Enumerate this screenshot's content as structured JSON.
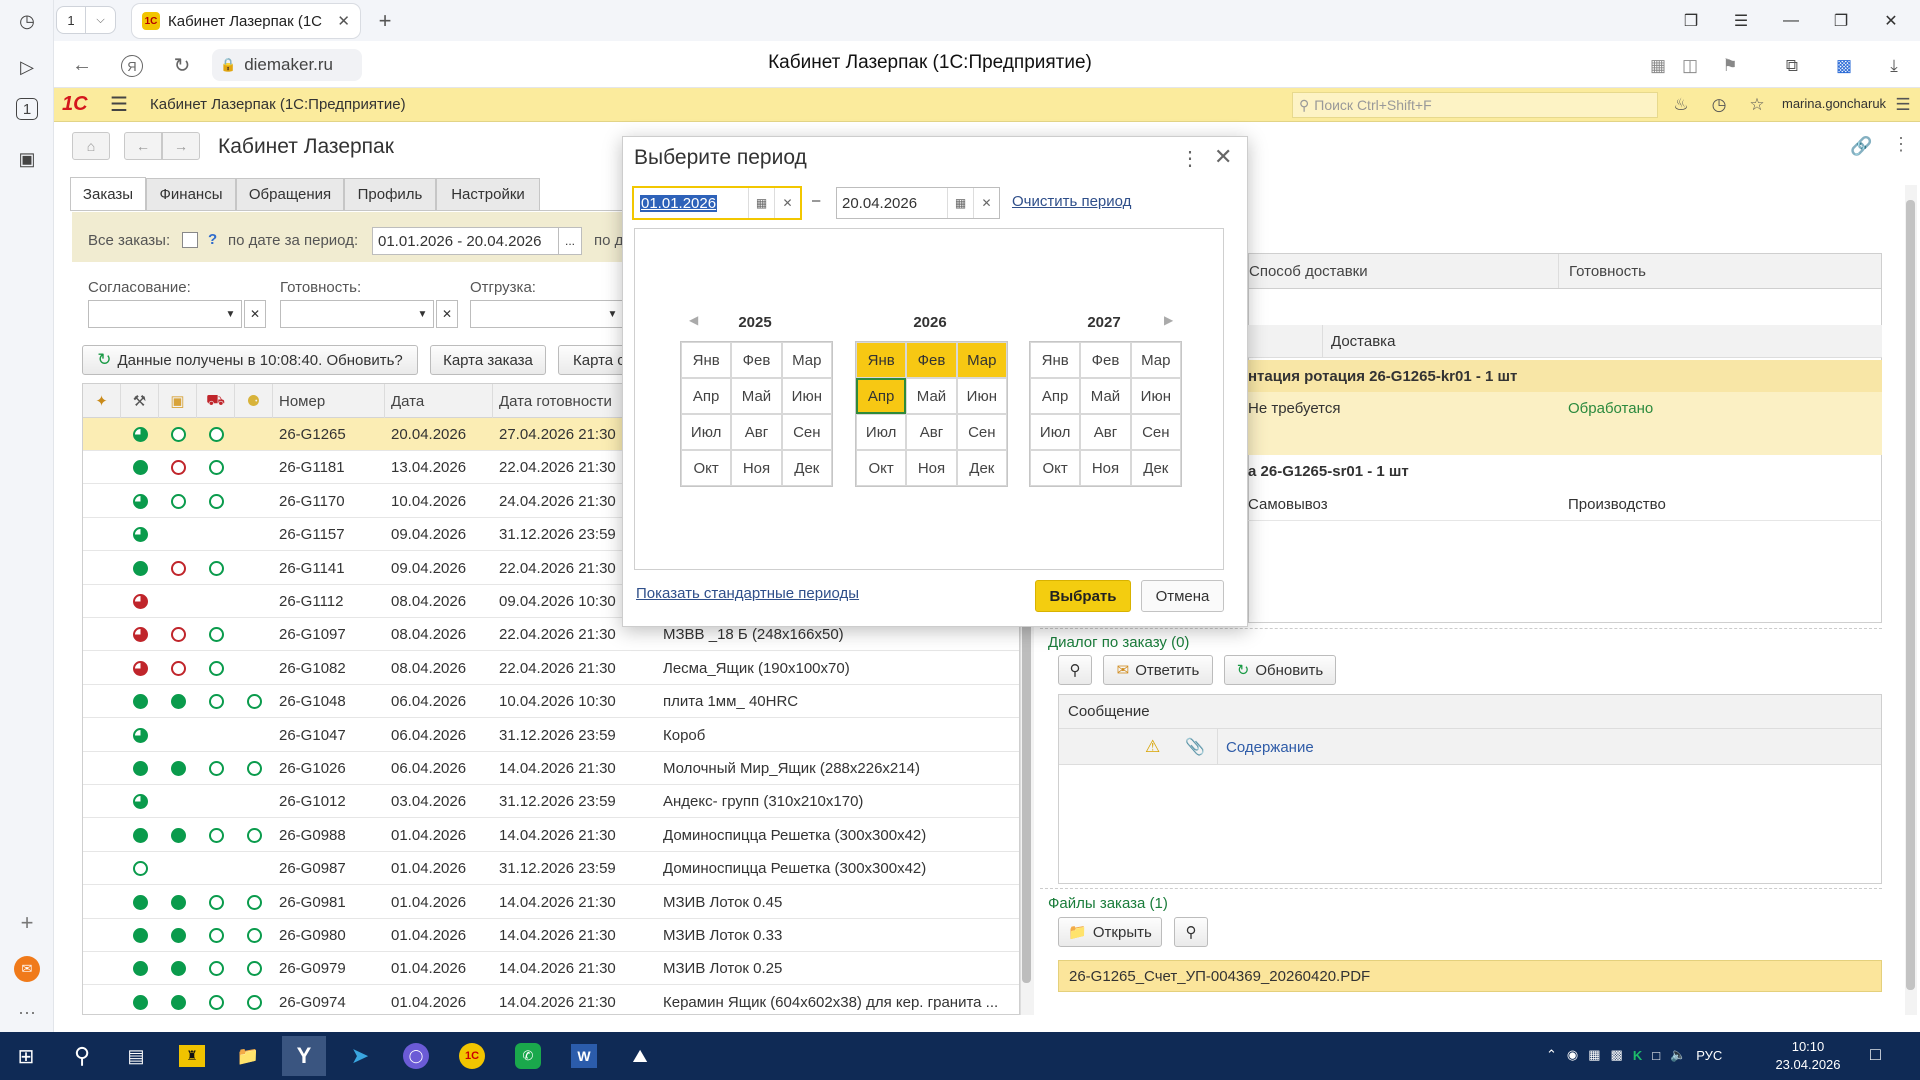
{
  "browser": {
    "tab_count": "1",
    "active_tab_title": "Кабинет Лазерпак (1С",
    "fav_label": "1С",
    "url": "diemaker.ru",
    "page_title": "Кабинет Лазерпак (1С:Предприятие)"
  },
  "app": {
    "logo": "1С",
    "title": "Кабинет Лазерпак  (1С:Предприятие)",
    "search_placeholder": "Поиск Ctrl+Shift+F",
    "user": "marina.goncharuk"
  },
  "form": {
    "title": "Кабинет Лазерпак",
    "tabs": [
      "Заказы",
      "Финансы",
      "Обращения",
      "Профиль",
      "Настройки"
    ]
  },
  "filters": {
    "all_orders_label": "Все заказы:",
    "help": "?",
    "period_label": "по дате за период:",
    "period_value": "01.01.2026 - 20.04.2026",
    "period_btn": "...",
    "extra_label": "по д",
    "agreement_label": "Согласование:",
    "readiness_label": "Готовность:",
    "shipment_label": "Отгрузка:"
  },
  "toolbar": {
    "refresh_label": "Данные получены в 10:08:40. Обновить?",
    "order_card": "Карта заказа",
    "card2": "Карта с"
  },
  "grid": {
    "columns": [
      "Номер",
      "Дата",
      "Дата готовности"
    ],
    "rows": [
      {
        "num": "26-G1265",
        "date": "20.04.2026",
        "ready": "27.04.2026 21:30",
        "desc": "",
        "icons": [
          "halfg",
          "ring",
          "ring",
          ""
        ]
      },
      {
        "num": "26-G1181",
        "date": "13.04.2026",
        "ready": "22.04.2026 21:30",
        "desc": "",
        "icons": [
          "green",
          "redring",
          "ring",
          ""
        ]
      },
      {
        "num": "26-G1170",
        "date": "10.04.2026",
        "ready": "24.04.2026 21:30",
        "desc": "",
        "icons": [
          "halfg",
          "ring",
          "ring",
          ""
        ]
      },
      {
        "num": "26-G1157",
        "date": "09.04.2026",
        "ready": "31.12.2026 23:59",
        "desc": "",
        "icons": [
          "halfg",
          "",
          "",
          ""
        ]
      },
      {
        "num": "26-G1141",
        "date": "09.04.2026",
        "ready": "22.04.2026 21:30",
        "desc": "",
        "icons": [
          "green",
          "redring",
          "ring",
          ""
        ]
      },
      {
        "num": "26-G1112",
        "date": "08.04.2026",
        "ready": "09.04.2026 10:30",
        "desc": "",
        "icons": [
          "halfr",
          "",
          "",
          ""
        ]
      },
      {
        "num": "26-G1097",
        "date": "08.04.2026",
        "ready": "22.04.2026 21:30",
        "desc": "МЗВВ _18 Б (248x166x50)",
        "icons": [
          "halfr",
          "redring",
          "ring",
          ""
        ]
      },
      {
        "num": "26-G1082",
        "date": "08.04.2026",
        "ready": "22.04.2026 21:30",
        "desc": "Лесма_Ящик (190x100x70)",
        "icons": [
          "halfr",
          "redring",
          "ring",
          ""
        ]
      },
      {
        "num": "26-G1048",
        "date": "06.04.2026",
        "ready": "10.04.2026 10:30",
        "desc": "плита 1мм_ 40HRC",
        "icons": [
          "green",
          "green",
          "ring",
          "ring"
        ]
      },
      {
        "num": "26-G1047",
        "date": "06.04.2026",
        "ready": "31.12.2026 23:59",
        "desc": "Короб",
        "icons": [
          "halfg",
          "",
          "",
          ""
        ]
      },
      {
        "num": "26-G1026",
        "date": "06.04.2026",
        "ready": "14.04.2026 21:30",
        "desc": "Молочный Мир_Ящик (288x226x214)",
        "icons": [
          "green",
          "green",
          "ring",
          "ring"
        ]
      },
      {
        "num": "26-G1012",
        "date": "03.04.2026",
        "ready": "31.12.2026 23:59",
        "desc": "Андекс- групп (310x210x170)",
        "icons": [
          "halfg",
          "",
          "",
          ""
        ]
      },
      {
        "num": "26-G0988",
        "date": "01.04.2026",
        "ready": "14.04.2026 21:30",
        "desc": "Доминоспицца Решетка (300x300x42)",
        "icons": [
          "green",
          "green",
          "ring",
          "ring"
        ]
      },
      {
        "num": "26-G0987",
        "date": "01.04.2026",
        "ready": "31.12.2026 23:59",
        "desc": "Доминоспицца Решетка (300x300x42)",
        "icons": [
          "ring",
          "",
          "",
          ""
        ]
      },
      {
        "num": "26-G0981",
        "date": "01.04.2026",
        "ready": "14.04.2026 21:30",
        "desc": "МЗИВ Лоток 0.45",
        "icons": [
          "green",
          "green",
          "ring",
          "ring"
        ]
      },
      {
        "num": "26-G0980",
        "date": "01.04.2026",
        "ready": "14.04.2026 21:30",
        "desc": "МЗИВ Лоток 0.33",
        "icons": [
          "green",
          "green",
          "ring",
          "ring"
        ]
      },
      {
        "num": "26-G0979",
        "date": "01.04.2026",
        "ready": "14.04.2026 21:30",
        "desc": "МЗИВ Лоток 0.25",
        "icons": [
          "green",
          "green",
          "ring",
          "ring"
        ]
      },
      {
        "num": "26-G0974",
        "date": "01.04.2026",
        "ready": "14.04.2026 21:30",
        "desc": "Керамин Ящик (604x602x38) для кер. гранита ...",
        "icons": [
          "green",
          "green",
          "ring",
          "ring"
        ]
      }
    ]
  },
  "right_panel": {
    "col_delivery_method": "Способ доставки",
    "col_readiness": "Готовность",
    "subcol_delivery": "Доставка",
    "item1_title": "нтация ротация 26-G1265-kr01 - 1 шт",
    "item1_delivery": "Не требуется",
    "item1_status": "Обработано",
    "item2_title": "а 26-G1265-sr01 - 1 шт",
    "item2_delivery": "Самовывоз",
    "item2_status": "Производство",
    "dialog_label": "Диалог по заказу (0)",
    "reply_btn": "Ответить",
    "refresh_btn": "Обновить",
    "msg_header": "Сообщение",
    "content_header": "Содержание",
    "files_label": "Файлы заказа (1)",
    "open_btn": "Открыть",
    "file_name": "26-G1265_Счет_УП-004369_20260420.PDF"
  },
  "modal": {
    "title": "Выберите период",
    "date_from": "01.01.2026",
    "dash": "–",
    "date_to": "20.04.2026",
    "clear_link": "Очистить период",
    "years": [
      "2025",
      "2026",
      "2027"
    ],
    "months": [
      "Янв",
      "Фев",
      "Мар",
      "Апр",
      "Май",
      "Июн",
      "Июл",
      "Авг",
      "Сен",
      "Окт",
      "Ноя",
      "Дек"
    ],
    "std_periods_link": "Показать стандартные периоды",
    "choose_btn": "Выбрать",
    "cancel_btn": "Отмена"
  },
  "taskbar": {
    "lang": "РУС",
    "time": "10:10",
    "date": "23.04.2026"
  }
}
